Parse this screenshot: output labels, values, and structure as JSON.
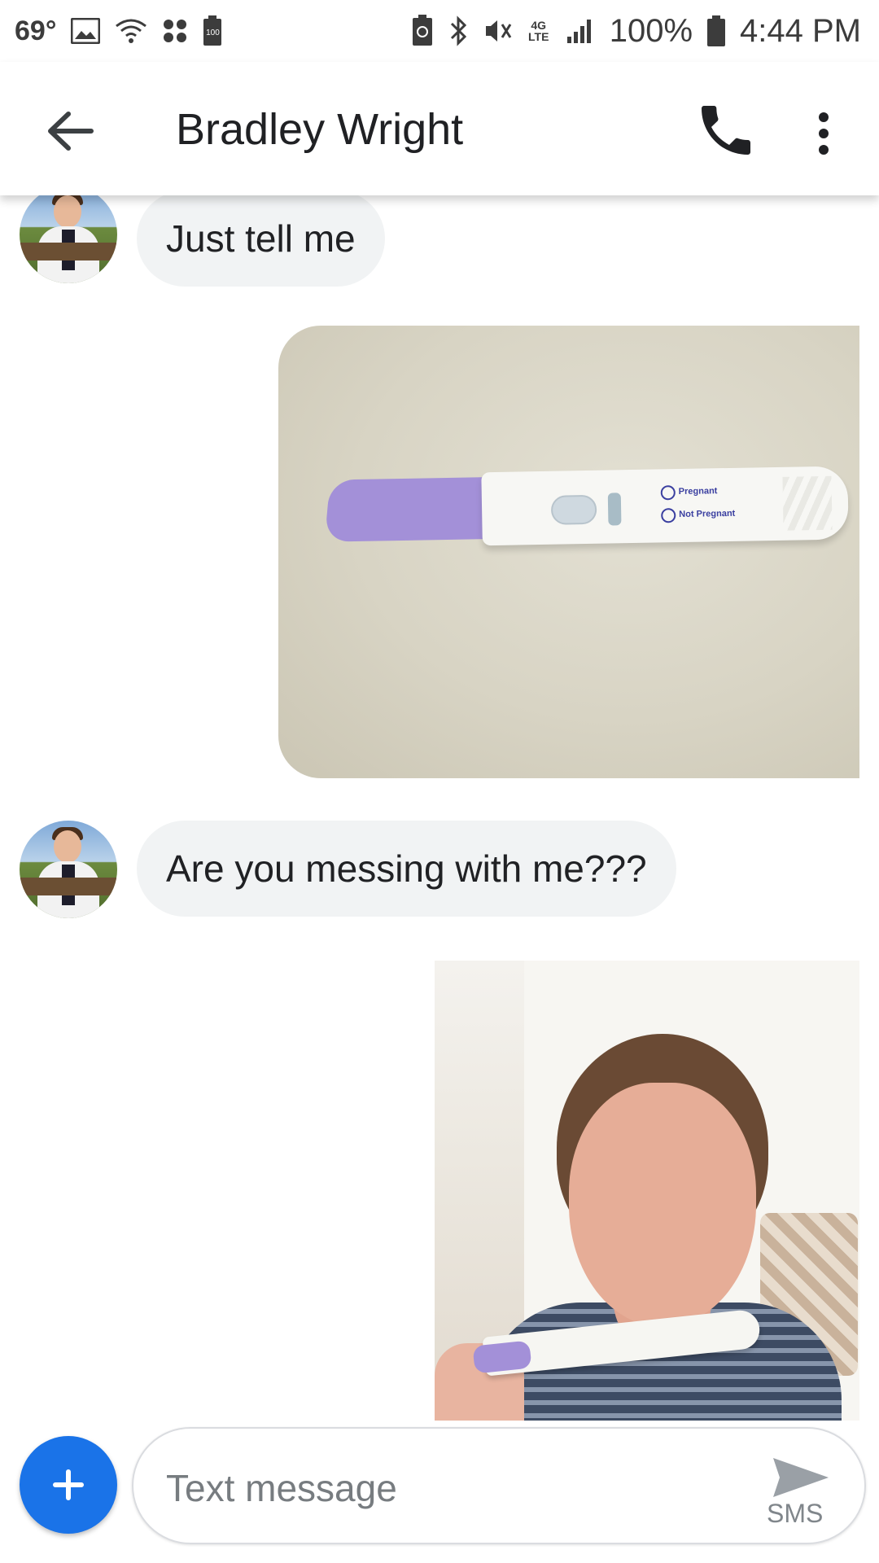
{
  "status_bar": {
    "temperature": "69°",
    "battery_saver_badge": "100",
    "network": "4G LTE",
    "battery_percent": "100%",
    "time": "4:44 PM"
  },
  "app_bar": {
    "contact_name": "Bradley Wright"
  },
  "messages": [
    {
      "direction": "incoming",
      "type": "text",
      "text": "Just tell me"
    },
    {
      "direction": "outgoing",
      "type": "image",
      "image_text": {
        "pregnant_label": "Pregnant",
        "not_pregnant_label": "Not Pregnant"
      }
    },
    {
      "direction": "incoming",
      "type": "text",
      "text": "Are you messing with me???"
    },
    {
      "direction": "outgoing",
      "type": "image"
    }
  ],
  "compose": {
    "placeholder": "Text message",
    "send_label": "SMS"
  },
  "colors": {
    "accent": "#1a73e8",
    "incoming_bubble": "#f1f3f4"
  }
}
